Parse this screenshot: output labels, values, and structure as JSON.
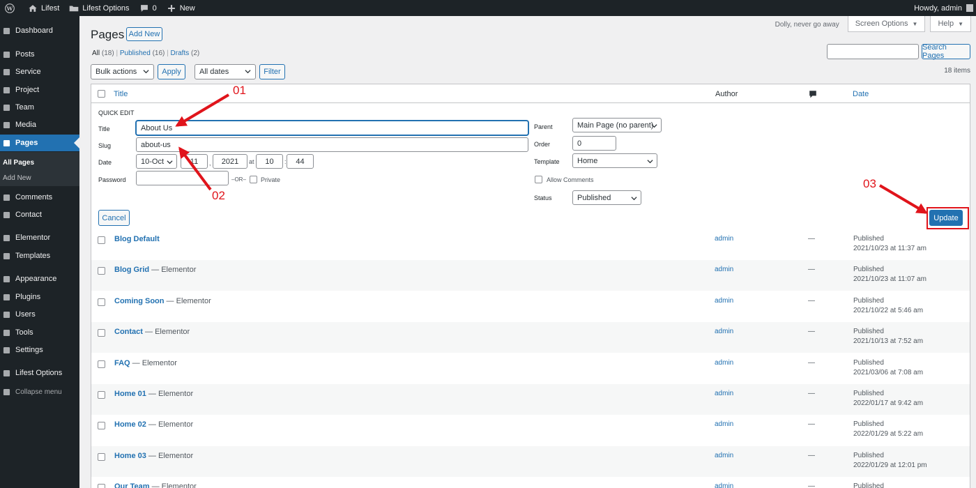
{
  "adminbar": {
    "site_name": "Lifest",
    "options": "Lifest Options",
    "comments_count": "0",
    "new_label": "New",
    "howdy": "Howdy, admin"
  },
  "sidebar": {
    "items": [
      {
        "label": "Dashboard",
        "icon": "dashboard-icon"
      },
      {
        "label": "Posts",
        "icon": "pin-icon"
      },
      {
        "label": "Service",
        "icon": "grid-icon"
      },
      {
        "label": "Project",
        "icon": "grid-icon"
      },
      {
        "label": "Team",
        "icon": "grid-icon"
      },
      {
        "label": "Media",
        "icon": "media-icon"
      },
      {
        "label": "Pages",
        "icon": "pages-icon"
      },
      {
        "label": "Comments",
        "icon": "comment-icon"
      },
      {
        "label": "Contact",
        "icon": "mail-icon"
      },
      {
        "label": "Elementor",
        "icon": "elementor-icon"
      },
      {
        "label": "Templates",
        "icon": "folder-icon"
      },
      {
        "label": "Appearance",
        "icon": "brush-icon"
      },
      {
        "label": "Plugins",
        "icon": "plug-icon"
      },
      {
        "label": "Users",
        "icon": "user-icon"
      },
      {
        "label": "Tools",
        "icon": "wrench-icon"
      },
      {
        "label": "Settings",
        "icon": "settings-icon"
      },
      {
        "label": "Lifest Options",
        "icon": "cog-icon"
      },
      {
        "label": "Collapse menu",
        "icon": "collapse-icon"
      }
    ],
    "submenu": [
      "All Pages",
      "Add New"
    ]
  },
  "header": {
    "title": "Pages",
    "add_new": "Add New",
    "dolly": "Dolly, never go away",
    "screen_options": "Screen Options",
    "help": "Help"
  },
  "filters": {
    "all": "All",
    "all_count": "(18)",
    "published": "Published",
    "published_count": "(16)",
    "drafts": "Drafts",
    "drafts_count": "(2)",
    "sep": "|",
    "bulk_actions": "Bulk actions",
    "apply": "Apply",
    "all_dates": "All dates",
    "filter": "Filter",
    "search_pages": "Search Pages",
    "items_count": "18 items"
  },
  "table": {
    "col_title": "Title",
    "col_author": "Author",
    "col_date": "Date"
  },
  "quick_edit": {
    "heading": "QUICK EDIT",
    "title_label": "Title",
    "title_value": "About Us",
    "slug_label": "Slug",
    "slug_value": "about-us",
    "date_label": "Date",
    "month": "10-Oct",
    "day": "11",
    "year": "2021",
    "at": "at",
    "hour": "10",
    "minute": "44",
    "comma": ",",
    "colon": ":",
    "password_label": "Password",
    "or": "–OR–",
    "private": "Private",
    "parent_label": "Parent",
    "parent_value": "Main Page (no parent)",
    "order_label": "Order",
    "order_value": "0",
    "template_label": "Template",
    "template_value": "Home",
    "allow_comments": "Allow Comments",
    "status_label": "Status",
    "status_value": "Published",
    "cancel": "Cancel",
    "update": "Update"
  },
  "rows": [
    {
      "name": "Blog Default",
      "suffix": "",
      "author": "admin",
      "comments": "—",
      "status": "Published",
      "date": "2021/10/23 at 11:37 am"
    },
    {
      "name": "Blog Grid",
      "suffix": " — Elementor",
      "author": "admin",
      "comments": "—",
      "status": "Published",
      "date": "2021/10/23 at 11:07 am"
    },
    {
      "name": "Coming Soon",
      "suffix": " — Elementor",
      "author": "admin",
      "comments": "—",
      "status": "Published",
      "date": "2021/10/22 at 5:46 am"
    },
    {
      "name": "Contact",
      "suffix": " — Elementor",
      "author": "admin",
      "comments": "—",
      "status": "Published",
      "date": "2021/10/13 at 7:52 am"
    },
    {
      "name": "FAQ",
      "suffix": " — Elementor",
      "author": "admin",
      "comments": "—",
      "status": "Published",
      "date": "2021/03/06 at 7:08 am"
    },
    {
      "name": "Home 01",
      "suffix": " — Elementor",
      "author": "admin",
      "comments": "—",
      "status": "Published",
      "date": "2022/01/17 at 9:42 am"
    },
    {
      "name": "Home 02",
      "suffix": " — Elementor",
      "author": "admin",
      "comments": "—",
      "status": "Published",
      "date": "2022/01/29 at 5:22 am"
    },
    {
      "name": "Home 03",
      "suffix": " — Elementor",
      "author": "admin",
      "comments": "—",
      "status": "Published",
      "date": "2022/01/29 at 12:01 pm"
    },
    {
      "name": "Our Team",
      "suffix": " — Elementor",
      "author": "admin",
      "comments": "—",
      "status": "Published",
      "date": ""
    }
  ],
  "annotations": {
    "a1": "01",
    "a2": "02",
    "a3": "03",
    "color": "#e0141b"
  },
  "colors": {
    "accent": "#2271b1",
    "adminbar": "#1d2327",
    "annotation": "#e0141b"
  }
}
